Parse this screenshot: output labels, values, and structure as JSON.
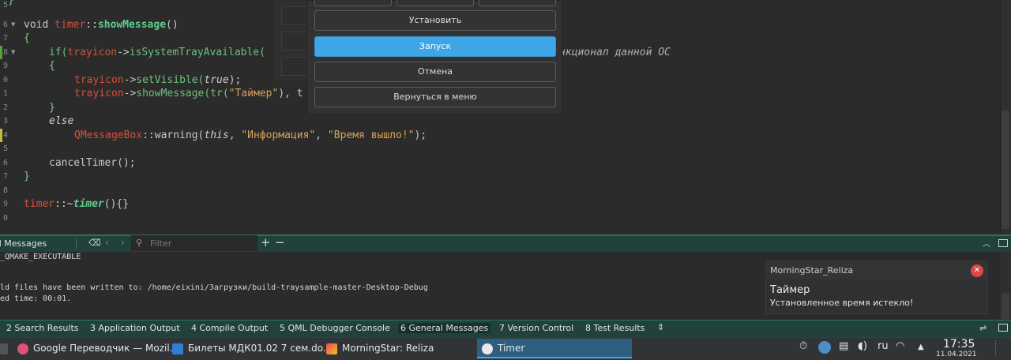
{
  "editor": {
    "line_numbers": [
      "5",
      "6",
      "7",
      "8",
      "9",
      "0",
      "1",
      "2",
      "3",
      "4",
      "5",
      "6",
      "7",
      "8",
      "9",
      "0"
    ],
    "lines": {
      "l1_void": "void ",
      "l1_class": "timer",
      "l1_sep": "::",
      "l1_fn": "showMessage",
      "l1_paren": "()",
      "l2": "{",
      "l3_if": "if(",
      "l3_obj": "trayicon",
      "l3_arrow": "->",
      "l3_fn": "isSystemTrayAvailable(",
      "l3_comment": "нкционал данной ОС",
      "l4": "{",
      "l5_obj": "trayicon",
      "l5_arrow": "->",
      "l5_fn": "setVisible(",
      "l5_arg": "true",
      "l5_end": ");",
      "l6_obj": "trayicon",
      "l6_arrow": "->",
      "l6_fn": "showMessage(",
      "l6_tr": "tr(",
      "l6_str": "\"Таймер\"",
      "l6_rest": "), t",
      "l7": "}",
      "l8": "else",
      "l9_class": "QMessageBox",
      "l9_sep": "::",
      "l9_fn": "warning(",
      "l9_this": "this",
      "l9_comma": ", ",
      "l9_str1": "\"Информация\"",
      "l9_comma2": ", ",
      "l9_str2": "\"Время вышло!\"",
      "l9_end": ");",
      "l10": "cancelTimer();",
      "l11": "}",
      "l12_class": "timer",
      "l12_sep": "::~",
      "l12_fn": "timer",
      "l12_end": "(){}"
    }
  },
  "dialog": {
    "set_label": "Установить",
    "start_label": "Запуск",
    "cancel_label": "Отмена",
    "menu_label": "Вернуться в меню"
  },
  "output_pane": {
    "title": "al Messages",
    "filter_placeholder": "Filter",
    "plus": "+",
    "minus": "−",
    "lines": [
      "_QMAKE_EXECUTABLE",
      "ld files have been written to: /home/eixini/Загрузки/build-traysample-master-Desktop-Debug",
      "ed time: 00:01."
    ]
  },
  "notification": {
    "app": "MorningStar_Reliza",
    "title": "Таймер",
    "body": "Установленное время истекло!",
    "close": "✕"
  },
  "tabs": [
    {
      "label": "2 Search Results"
    },
    {
      "label": "3 Application Output"
    },
    {
      "label": "4 Compile Output"
    },
    {
      "label": "5 QML Debugger Console"
    },
    {
      "label": "6 General Messages"
    },
    {
      "label": "7 Version Control"
    },
    {
      "label": "8 Test Results"
    }
  ],
  "taskbar": {
    "tasks": [
      {
        "label": "Google Переводчик — Mozil..."
      },
      {
        "label": "Билеты МДК01.02 7 сем.do..."
      },
      {
        "label": "MorningStar: Reliza"
      },
      {
        "label": "Timer"
      }
    ],
    "lang": "ru",
    "time": "17:35",
    "date": "11.04.2021"
  },
  "colors": {
    "accent": "#3daee9",
    "primary_button": "#3ea6e6",
    "pane_header": "#21413b",
    "notification_close": "#e04848"
  }
}
